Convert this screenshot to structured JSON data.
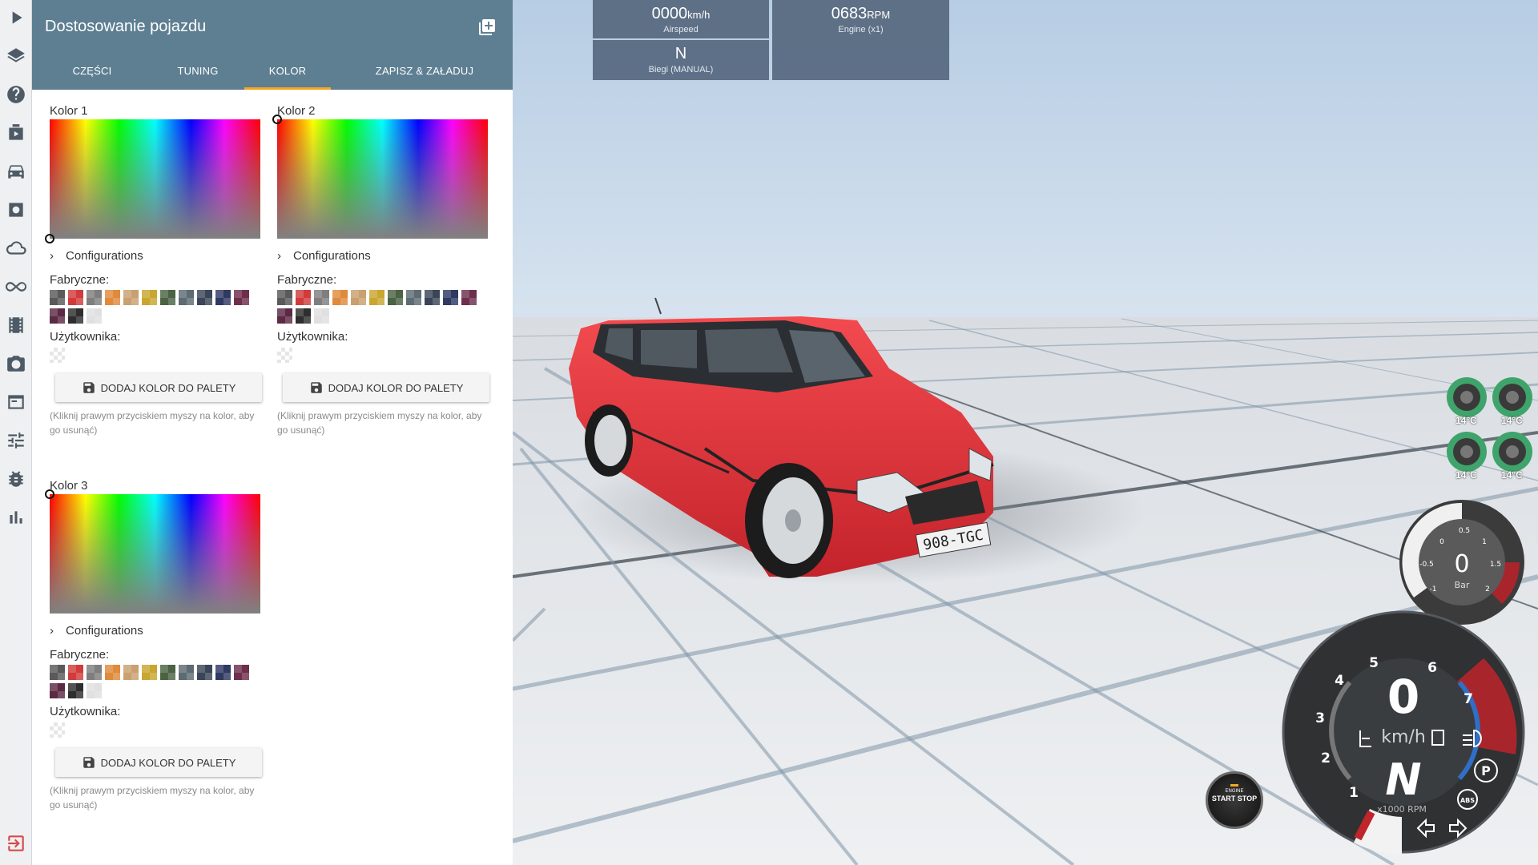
{
  "panel": {
    "title": "Dostosowanie pojazdu",
    "tabs": [
      {
        "label": "CZĘŚCI"
      },
      {
        "label": "TUNING"
      },
      {
        "label": "KOLOR"
      },
      {
        "label": "ZAPISZ & ZAŁADUJ"
      }
    ],
    "active_tab": "KOLOR",
    "colors": [
      {
        "label": "Kolor 1",
        "configurations": "Configurations",
        "factory_label": "Fabryczne:",
        "user_label": "Użytkownika:",
        "add_button": "DODAJ KOLOR DO PALETY",
        "hint": "(Kliknij prawym przyciskiem myszy na kolor, aby go usunąć)"
      },
      {
        "label": "Kolor 2",
        "configurations": "Configurations",
        "factory_label": "Fabryczne:",
        "user_label": "Użytkownika:",
        "add_button": "DODAJ KOLOR DO PALETY",
        "hint": "(Kliknij prawym przyciskiem myszy na kolor, aby go usunąć)"
      },
      {
        "label": "Kolor 3",
        "configurations": "Configurations",
        "factory_label": "Fabryczne:",
        "user_label": "Użytkownika:",
        "add_button": "DODAJ KOLOR DO PALETY",
        "hint": "(Kliknij prawym przyciskiem myszy na kolor, aby go usunąć)"
      }
    ],
    "factory_swatches": [
      "#5a5a5a",
      "#d13b3b",
      "#7e7e7e",
      "#e08a3c",
      "#c9a070",
      "#c8a630",
      "#4b6342",
      "#5d6b73",
      "#3a4658",
      "#2f3a63",
      "#6e2f4d",
      "#5c2a45",
      "#2e2e2e",
      "#e0e0e0"
    ]
  },
  "rail": {
    "icons": [
      "play-icon",
      "layers-icon",
      "help-icon",
      "scenario-icon",
      "car-icon",
      "settings-icon",
      "cloud-icon",
      "infinity-icon",
      "film-icon",
      "camera-icon",
      "window-icon",
      "sliders-icon",
      "bug-icon",
      "chart-icon"
    ],
    "exit_icon": "exit-icon"
  },
  "hud": {
    "airspeed_value": "0000",
    "airspeed_unit": "km/h",
    "airspeed_label": "Airspeed",
    "rpm_value": "0683",
    "rpm_unit": "RPM",
    "rpm_label": "Engine (x1)",
    "gear_value": "N",
    "gear_label": "Biegi (MANUAL)"
  },
  "gauges": {
    "wheel_temps": [
      "14°C",
      "14°C",
      "14°C",
      "14°C"
    ],
    "boost_value": "0",
    "boost_unit": "Bar",
    "boost_ticks": [
      "-1",
      "-0.5",
      "0",
      "0.5",
      "1",
      "1.5",
      "2"
    ],
    "speed_value": "0",
    "speed_unit": "km/h",
    "gear_display": "N",
    "rpm_unit_label": "x1000 RPM",
    "rpm_ticks": [
      "1",
      "2",
      "3",
      "4",
      "5",
      "6",
      "7"
    ],
    "start_stop_top": "ENGINE",
    "start_stop_main": "START STOP",
    "parking_label": "P",
    "abs_label": "ABS"
  },
  "vehicle": {
    "plate": "908-TGC",
    "body_color": "#e8333a"
  }
}
